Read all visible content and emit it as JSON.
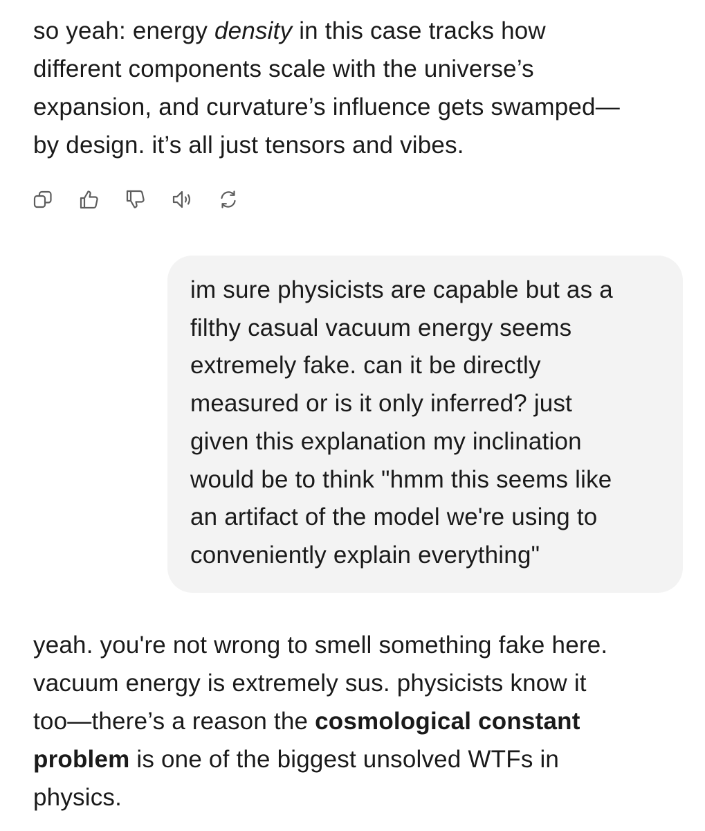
{
  "assistant_message_1": {
    "lines": [
      {
        "pre": "so yeah: energy ",
        "em": "density",
        "post": " in this case tracks how"
      },
      {
        "text": "different components scale with the universe’s"
      },
      {
        "text": "expansion, and curvature’s influence gets swamped—"
      },
      {
        "text": "by design. it’s all just tensors and vibes."
      }
    ]
  },
  "message_actions": [
    {
      "name": "copy-icon"
    },
    {
      "name": "thumbs-up-icon"
    },
    {
      "name": "thumbs-down-icon"
    },
    {
      "name": "read-aloud-icon"
    },
    {
      "name": "regenerate-icon"
    }
  ],
  "user_message": {
    "lines": [
      "im sure physicists are capable but as a",
      "filthy casual vacuum energy seems",
      "extremely fake. can it be directly",
      "measured or is it only inferred? just",
      "given this explanation my inclination",
      "would be to think \"hmm this seems like",
      "an artifact of the model we're using to",
      "conveniently explain everything\""
    ]
  },
  "assistant_message_2": {
    "line1": "yeah. you're not wrong to smell something fake here.",
    "line2": "vacuum energy is extremely sus. physicists know it",
    "line3_pre": "too—there’s a reason the ",
    "line3_bold": "cosmological constant",
    "line4_bold": "problem",
    "line4_post": " is one of the biggest unsolved WTFs in",
    "line5": "physics."
  },
  "colors": {
    "text": "#1a1a1a",
    "bubble_bg": "#f3f3f3",
    "icon": "#5d5d5d"
  }
}
